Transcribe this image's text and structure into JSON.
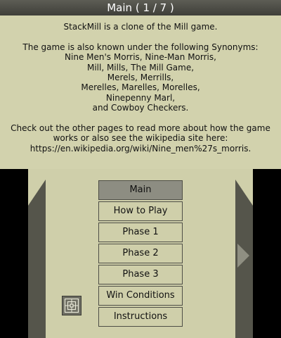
{
  "title": {
    "label": "Main",
    "page": "( 1 / 7 )"
  },
  "body": {
    "paragraph1": "StackMill is a clone of the Mill game.",
    "paragraph2_lines": [
      "The game is also known under the following Synonyms:",
      "Nine Men's Morris, Nine-Man Morris,",
      "Mill, Mills, The Mill Game,",
      "Merels, Merrills,",
      "Merelles, Marelles, Morelles,",
      "Ninepenny Marl,",
      "and Cowboy Checkers."
    ],
    "paragraph3_lines": [
      "Check out the other pages to read more about how the game",
      "works or also see the wikipedia site here:",
      "https://en.wikipedia.org/wiki/Nine_men%27s_morris."
    ]
  },
  "menu": {
    "items": [
      {
        "label": "Main",
        "active": true
      },
      {
        "label": "How to Play",
        "active": false
      },
      {
        "label": "Phase 1",
        "active": false
      },
      {
        "label": "Phase 2",
        "active": false
      },
      {
        "label": "Phase 3",
        "active": false
      },
      {
        "label": "Win Conditions",
        "active": false
      },
      {
        "label": "Instructions",
        "active": false
      }
    ]
  },
  "icons": {
    "board": "mill-board-icon",
    "prev": "left-arrow-icon",
    "next": "right-arrow-icon"
  },
  "colors": {
    "background": "#d2d2ad",
    "title_bar": "#4a4a43",
    "active_item": "#8d8d82",
    "panel": "#55554b"
  }
}
